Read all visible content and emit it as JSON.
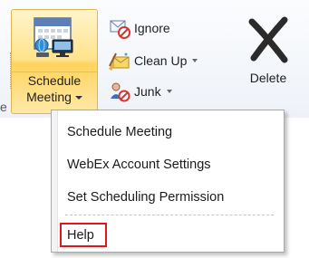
{
  "ribbon": {
    "schedule_meeting": {
      "label_line1": "Schedule",
      "label_line2": "Meeting",
      "icon": "calendar-webex-icon"
    },
    "ignore": {
      "label": "Ignore",
      "icon": "ignore-conversation-icon"
    },
    "clean_up": {
      "label": "Clean Up",
      "icon": "clean-up-icon"
    },
    "junk": {
      "label": "Junk",
      "icon": "junk-icon"
    },
    "delete": {
      "label": "Delete",
      "icon": "delete-x-icon"
    },
    "left_stub": "e"
  },
  "menu": {
    "items": [
      {
        "label": "Schedule Meeting"
      },
      {
        "label": "WebEx Account Settings"
      },
      {
        "label": "Set Scheduling Permission"
      },
      {
        "label": "Help",
        "highlighted_by_red_box": true
      }
    ]
  },
  "colors": {
    "highlight_button": "#ffe38c",
    "annotation_red": "#e0161d",
    "delete_x": "#2b2b2b"
  }
}
